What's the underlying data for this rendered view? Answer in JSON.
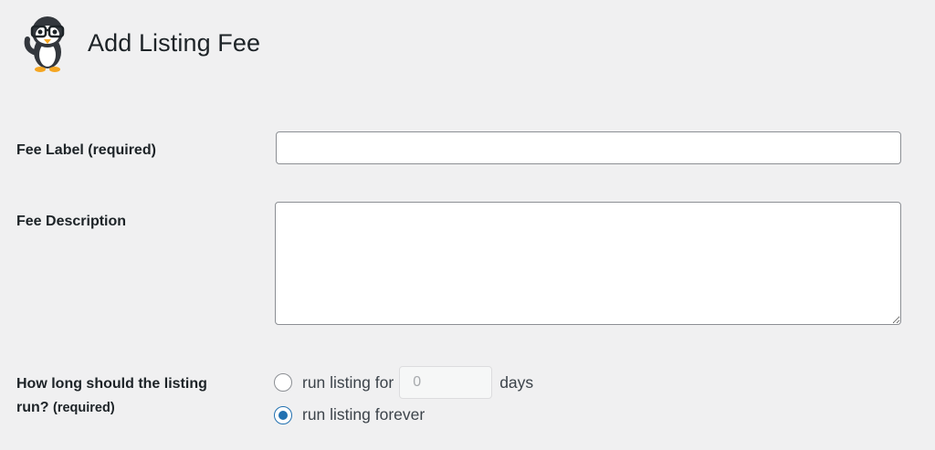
{
  "header": {
    "logo_icon": "penguin-mascot-logo",
    "title": "Add Listing Fee"
  },
  "form": {
    "fee_label": {
      "label": "Fee Label (required)",
      "value": "",
      "placeholder": ""
    },
    "fee_description": {
      "label": "Fee Description",
      "value": "",
      "placeholder": ""
    },
    "duration": {
      "label_main": "How long should the listing",
      "label_line2": "run?",
      "label_required": "(required)",
      "option_run_for_label": "run listing for",
      "days_value": "0",
      "days_unit": "days",
      "option_forever_label": "run listing forever",
      "selected": "forever"
    }
  },
  "colors": {
    "background": "#f0f0f1",
    "accent": "#2271b1",
    "input_border": "#8c8f94"
  }
}
